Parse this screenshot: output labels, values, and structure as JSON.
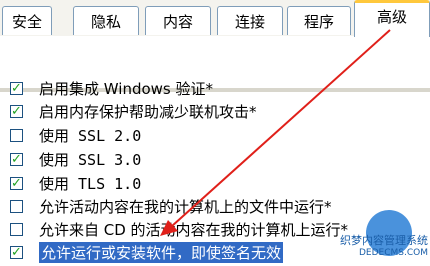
{
  "tabs": [
    {
      "label": "安全"
    },
    {
      "label": "隐私"
    },
    {
      "label": "内容"
    },
    {
      "label": "连接"
    },
    {
      "label": "程序"
    },
    {
      "label": "高级",
      "active": true
    }
  ],
  "options": [
    {
      "label": "启用集成 Windows 验证*",
      "checked": true
    },
    {
      "label": "启用内存保护帮助减少联机攻击*",
      "checked": true
    },
    {
      "label": "使用 SSL 2.0",
      "checked": false
    },
    {
      "label": "使用 SSL 3.0",
      "checked": true
    },
    {
      "label": "使用 TLS 1.0",
      "checked": true
    },
    {
      "label": "允许活动内容在我的计算机上的文件中运行*",
      "checked": false
    },
    {
      "label": "允许来自 CD 的活动内容在我的计算机上运行*",
      "checked": false
    },
    {
      "label": "允许运行或安装软件，即使签名无效",
      "checked": true,
      "selected": true
    }
  ],
  "annotation": {
    "color": "#e0201a"
  },
  "watermark": {
    "brand": "织梦内容管理系统",
    "url": "DEDECMS.COM"
  },
  "colors": {
    "selection": "#316ac5",
    "tab_border": "#7f9db9",
    "active_tab_accent": "#ffc83c",
    "check": "#21a121"
  }
}
